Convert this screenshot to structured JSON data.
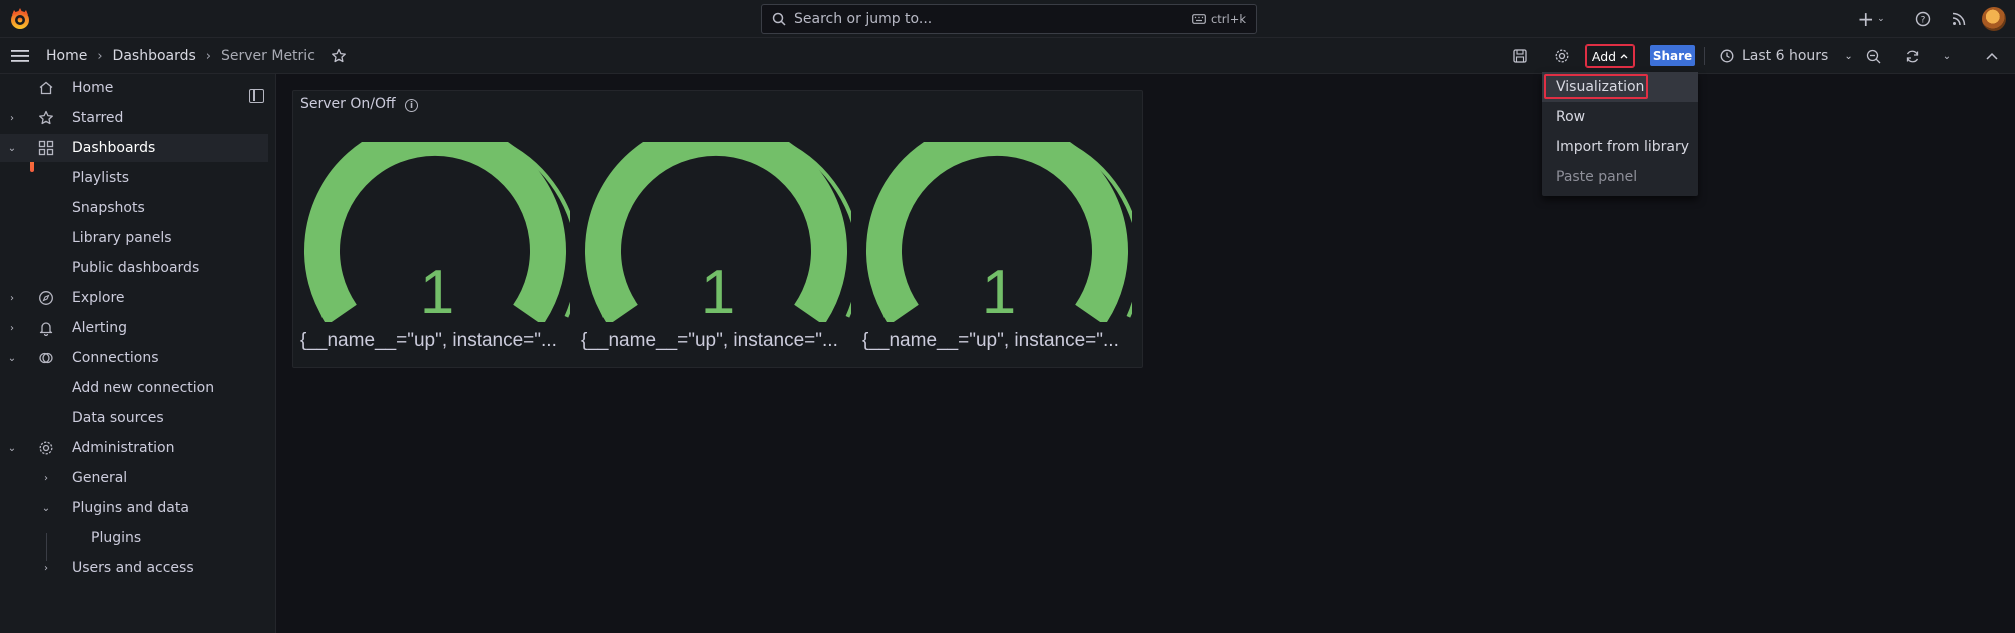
{
  "search": {
    "placeholder": "Search or jump to...",
    "shortcut": "ctrl+k"
  },
  "breadcrumb": {
    "home": "Home",
    "dashboards": "Dashboards",
    "current": "Server Metric"
  },
  "toolbar": {
    "add_label": "Add",
    "share_label": "Share",
    "time_range": "Last 6 hours"
  },
  "sidebar": {
    "items": [
      {
        "label": "Home",
        "icon": "home-icon"
      },
      {
        "label": "Starred",
        "icon": "star-icon"
      },
      {
        "label": "Dashboards",
        "icon": "apps-icon"
      },
      {
        "label": "Playlists"
      },
      {
        "label": "Snapshots"
      },
      {
        "label": "Library panels"
      },
      {
        "label": "Public dashboards"
      },
      {
        "label": "Explore",
        "icon": "compass-icon"
      },
      {
        "label": "Alerting",
        "icon": "bell-icon"
      },
      {
        "label": "Connections",
        "icon": "connections-icon"
      },
      {
        "label": "Add new connection"
      },
      {
        "label": "Data sources"
      },
      {
        "label": "Administration",
        "icon": "cog-icon"
      },
      {
        "label": "General"
      },
      {
        "label": "Plugins and data"
      },
      {
        "label": "Plugins"
      },
      {
        "label": "Users and access"
      }
    ]
  },
  "panel": {
    "title": "Server On/Off",
    "gauges": [
      {
        "value": "1",
        "label": "{__name__=\"up\", instance=\"..."
      },
      {
        "value": "1",
        "label": "{__name__=\"up\", instance=\"..."
      },
      {
        "value": "1",
        "label": "{__name__=\"up\", instance=\"..."
      }
    ]
  },
  "add_menu": {
    "items": [
      "Visualization",
      "Row",
      "Import from library",
      "Paste panel"
    ]
  },
  "colors": {
    "gauge_green": "#73bf69",
    "accent_orange": "#f55f3e",
    "share_blue": "#3d71d9",
    "highlight_red": "#e02f44"
  }
}
